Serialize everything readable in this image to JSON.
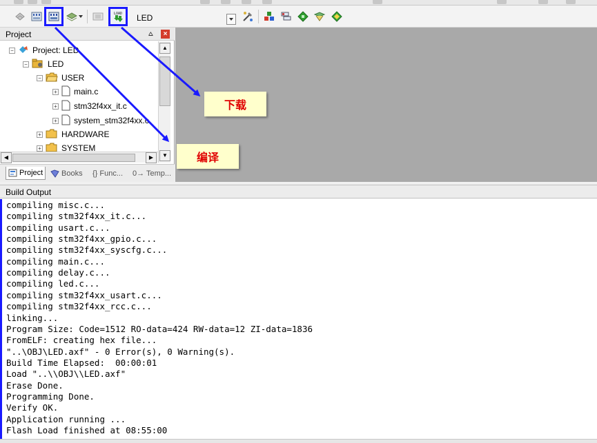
{
  "toolbar": {
    "target_name": "LED",
    "buttons": [
      "translate-icon",
      "build-icon",
      "rebuild-icon",
      "batch-build-icon",
      "stop-build-icon",
      "download-icon",
      "options-icon",
      "manage-components-icon",
      "pack-installer-icon",
      "select-packs-icon",
      "manage-rte-icon"
    ],
    "download_icon_text": "LOAD"
  },
  "project_panel": {
    "title": "Project",
    "pin": "⩟",
    "close": "×",
    "tree": [
      {
        "label": "Project: LED",
        "depth": 0,
        "expander": "−",
        "icon": "project-icon"
      },
      {
        "label": "LED",
        "depth": 1,
        "expander": "−",
        "icon": "target-icon"
      },
      {
        "label": "USER",
        "depth": 2,
        "expander": "−",
        "icon": "folder-icon"
      },
      {
        "label": "main.c",
        "depth": 3,
        "expander": "+",
        "icon": "file-icon"
      },
      {
        "label": "stm32f4xx_it.c",
        "depth": 3,
        "expander": "+",
        "icon": "file-icon"
      },
      {
        "label": "system_stm32f4xx.c",
        "depth": 3,
        "expander": "+",
        "icon": "file-icon"
      },
      {
        "label": "HARDWARE",
        "depth": 2,
        "expander": "+",
        "icon": "folder-icon"
      },
      {
        "label": "SYSTEM",
        "depth": 2,
        "expander": "+",
        "icon": "folder-icon"
      }
    ],
    "tabs": [
      {
        "label": "Project",
        "active": true
      },
      {
        "label": "Books",
        "active": false
      },
      {
        "label": "{} Func...",
        "active": false
      },
      {
        "label": "0→ Temp...",
        "active": false
      }
    ]
  },
  "build_output": {
    "title": "Build Output",
    "lines": [
      "compiling misc.c...",
      "compiling stm32f4xx_it.c...",
      "compiling usart.c...",
      "compiling stm32f4xx_gpio.c...",
      "compiling stm32f4xx_syscfg.c...",
      "compiling main.c...",
      "compiling delay.c...",
      "compiling led.c...",
      "compiling stm32f4xx_usart.c...",
      "compiling stm32f4xx_rcc.c...",
      "linking...",
      "Program Size: Code=1512 RO-data=424 RW-data=12 ZI-data=1836",
      "FromELF: creating hex file...",
      "\"..\\OBJ\\LED.axf\" - 0 Error(s), 0 Warning(s).",
      "Build Time Elapsed:  00:00:01",
      "Load \"..\\\\OBJ\\\\LED.axf\"",
      "Erase Done.",
      "Programming Done.",
      "Verify OK.",
      "Application running ...",
      "Flash Load finished at 08:55:00"
    ]
  },
  "annotations": {
    "download": "下载",
    "compile": "编译"
  },
  "colors": {
    "highlight": "#1a1aff",
    "callout_bg": "#ffffcc",
    "callout_text": "#e00000",
    "editor_bg": "#a9a9a9"
  }
}
